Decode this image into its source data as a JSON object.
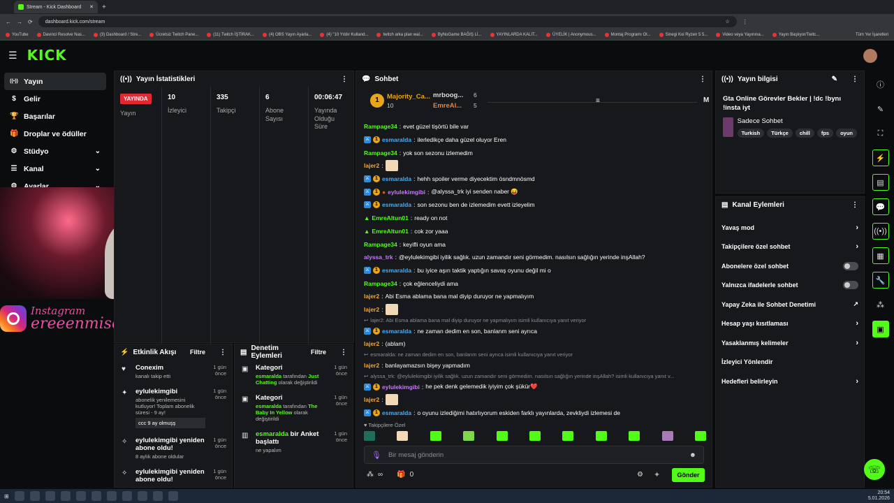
{
  "browser": {
    "tab_title": "Stream - Kick Dashboard",
    "url": "dashboard.kick.com/stream",
    "bookmarks": [
      "YouTube",
      "Davinci Resolve Nas...",
      "(3) Dashboard / Stre...",
      "Ücretsiz Twitch Pane...",
      "(11) Twitch İŞTİRAK...",
      "(4) OBS Yayın Ayarla...",
      "(4) \"10 Yıldır Kulland...",
      "twitch arka plan wal...",
      "ByNoGame BAĞIŞ Lİ...",
      "YAYINLARDA KALIT...",
      "ÜYELİK | Anonymous...",
      "Montaj Programı Ol...",
      "Sinegi Koi Ryzen 5 5...",
      "Video veya Yayınına...",
      "Yayın Başlıyor/Twitc..."
    ],
    "all_bookmarks": "Tüm Yer İşaretleri"
  },
  "app": {
    "logo": "KICK"
  },
  "sidebar": {
    "items": [
      {
        "label": "Yayın",
        "icon": "broadcast-icon",
        "active": true
      },
      {
        "label": "Gelir",
        "icon": "dollar-icon"
      },
      {
        "label": "Başarılar",
        "icon": "trophy-icon"
      },
      {
        "label": "Droplar ve ödüller",
        "icon": "gift-icon"
      },
      {
        "label": "Stüdyo",
        "icon": "gear-icon",
        "chevron": true
      },
      {
        "label": "Kanal",
        "icon": "list-icon",
        "chevron": true
      },
      {
        "label": "Ayarlar",
        "icon": "settings-icon",
        "chevron": true
      }
    ]
  },
  "overlay": {
    "instagram_label": "Instagram",
    "instagram_handle": "ereeenmise"
  },
  "stats": {
    "title": "Yayın İstatistikleri",
    "live_badge": "YAYINDA",
    "columns": [
      {
        "value": "",
        "label": "Yayın"
      },
      {
        "value": "10",
        "label": "İzleyici"
      },
      {
        "value": "335",
        "label": "Takipçi"
      },
      {
        "value": "6",
        "label": "Abone Sayısı"
      },
      {
        "value": "00:06:47",
        "label": "Yayında Olduğu Süre"
      }
    ]
  },
  "activity": {
    "title": "Etkinlik Akışı",
    "filter": "Filtre",
    "items": [
      {
        "who": "Conexim",
        "sub": "kanalı takip etti",
        "time": "1 gün önce",
        "icon": "heart-icon"
      },
      {
        "who": "eylulekimgibi",
        "sub": "abonelik yenilemesini kutluyor! Toplam abonelik süresi - 9 ay!",
        "extra": "ccc 9 ay olmuşş",
        "time": "1 gün önce",
        "icon": "star-icon"
      },
      {
        "who": "eylulekimgibi yeniden abone oldu!",
        "sub": "8 aylık abone oldular",
        "time": "1 gün önce",
        "icon": "sparkle-icon"
      },
      {
        "who": "eylulekimgibi yeniden abone oldu!",
        "sub": "",
        "time": "1 gün önce",
        "icon": "sparkle-icon"
      }
    ]
  },
  "audit": {
    "title": "Denetim Eylemleri",
    "filter": "Filtre",
    "items": [
      {
        "title": "Kategori",
        "who": "esmaralda",
        "mid": " tarafından ",
        "what": "Just Chatting",
        "end": " olarak değiştirildi",
        "time": "1 gün önce"
      },
      {
        "title": "Kategori",
        "who": "esmaralda",
        "mid": " tarafından ",
        "what": "The Baby In Yellow",
        "end": " olarak değiştirildi",
        "time": "1 gün önce"
      },
      {
        "title": " bir Anket başlattı",
        "who": "esmaralda",
        "mid": "",
        "what": "",
        "end": "ne yapalım",
        "time": "1 gün önce"
      }
    ]
  },
  "chat": {
    "title": "Sohbet",
    "pinned": [
      {
        "name": "Majority_Ca...",
        "count": "10"
      },
      {
        "name": "mrboog...",
        "count": "6"
      },
      {
        "name": "EmreAl...",
        "count": "5"
      }
    ],
    "pinned_extra": "M",
    "messages": [
      {
        "user": "Rampage34",
        "color": "#53fc18",
        "text": "evet güzel tişörtü bile var",
        "badges": 0
      },
      {
        "user": "esmaralda",
        "color": "#3fb0ff",
        "text": "ilerledikçe daha güzel oluyor Eren",
        "badges": 2
      },
      {
        "user": "Rampage34",
        "color": "#53fc18",
        "text": "yok son sezonu izlemedim",
        "badges": 0
      },
      {
        "user": "lajer2",
        "color": "#f0a63c",
        "text": "[emote]",
        "badges": 0
      },
      {
        "user": "esmaralda",
        "color": "#3fb0ff",
        "text": "hehh spoiler verme diyecektim ösndmnösmd",
        "badges": 2
      },
      {
        "user": "eylulekimgibi",
        "color": "#c87aff",
        "text": "@alyssa_trk iyi senden naber 😝",
        "badges": 3
      },
      {
        "user": "esmaralda",
        "color": "#3fb0ff",
        "text": "son sezonu ben de izlemedim evett izleyelim",
        "badges": 2
      },
      {
        "user": "EmreAltun01",
        "color": "#53fc18",
        "text": "ready on not",
        "badges": 1
      },
      {
        "user": "EmreAltun01",
        "color": "#53fc18",
        "text": "cok zor yaaa",
        "badges": 1
      },
      {
        "user": "Rampage34",
        "color": "#53fc18",
        "text": "keyifli oyun ama",
        "badges": 0
      },
      {
        "user": "alyssa_trk",
        "color": "#c87aff",
        "text": "@eylulekimgibi iyilik sağlık. uzun zamandır seni görmedim. nasılsın sağlığın yerinde inşAllah?",
        "badges": 0
      },
      {
        "user": "esmaralda",
        "color": "#3fb0ff",
        "text": "bu iyice aşırı taktik yaptığın savaş oyunu değil mi o",
        "badges": 2
      },
      {
        "user": "Rampage34",
        "color": "#53fc18",
        "text": "çok eğlenceliydi ama",
        "badges": 0
      },
      {
        "user": "lajer2",
        "color": "#f0a63c",
        "text": "Abi Esma ablama bana mal diyip duruyor ne yapmalıyım",
        "badges": 0
      },
      {
        "user": "lajer2",
        "color": "#f0a63c",
        "text": "[emote]",
        "badges": 0
      }
    ],
    "reply1": "lajer2: Abi Esma ablama bana mal diyip duruyor ne yapmalıyım isimli kullanıcıya yanıt veriyor",
    "messages2": [
      {
        "user": "esmaralda",
        "color": "#3fb0ff",
        "text": "ne zaman dedim en son, banlanm seni ayrıca",
        "badges": 2
      },
      {
        "user": "lajer2",
        "color": "#f0a63c",
        "text": "(ablam)",
        "badges": 0
      }
    ],
    "reply2": "esmaralda: ne zaman dedim en son, banlanm seni ayrıca isimli kullanıcıya yanıt veriyor",
    "messages3": [
      {
        "user": "lajer2",
        "color": "#f0a63c",
        "text": "banlayamazsın bişey yapmadım",
        "badges": 0
      }
    ],
    "reply3": "alyssa_trk: @eylulekimgibi iyilik sağlık. uzun zamandır seni görmedim. nasılsın sağlığın yerinde inşAllah? isimli kullanıcıya yanıt v...",
    "messages4": [
      {
        "user": "eylulekimgibi",
        "color": "#c87aff",
        "text": "he pek denk gelemedik iyiyim çok şükür❤️",
        "badges": 2
      },
      {
        "user": "lajer2",
        "color": "#f0a63c",
        "text": "[emote]",
        "badges": 0
      },
      {
        "user": "esmaralda",
        "color": "#3fb0ff",
        "text": "o oyunu izlediğimi hatırlıyorum eskiden farklı yayınlarda, zevkliydi izlemesi de",
        "badges": 2
      }
    ],
    "follower_only": "Takipçilere Özel",
    "input_placeholder": "Bir mesaj gönderin",
    "points": "∞",
    "gift_count": "0",
    "send_label": "Gönder"
  },
  "stream_info": {
    "title": "Yayın bilgisi",
    "stream_title": "Gta Online Görevler Bekler | !dc !bynı !insta iyt",
    "category": "Sadece Sohbet",
    "tags": [
      "Turkish",
      "Türkçe",
      "chill",
      "fps",
      "oyun"
    ]
  },
  "channel_actions": {
    "title": "Kanal Eylemleri",
    "items": [
      {
        "label": "Yavaş mod",
        "type": "chevron"
      },
      {
        "label": "Takipçilere özel sohbet",
        "type": "chevron"
      },
      {
        "label": "Abonelere özel sohbet",
        "type": "toggle"
      },
      {
        "label": "Yalnızca ifadelerle sohbet",
        "type": "toggle"
      },
      {
        "label": "Yapay Zeka ile Sohbet Denetimi",
        "type": "external"
      },
      {
        "label": "Hesap yaşı kısıtlaması",
        "type": "chevron"
      },
      {
        "label": "Yasaklanmış kelimeler",
        "type": "chevron"
      },
      {
        "label": "İzleyici Yönlendir",
        "type": "none"
      },
      {
        "label": "Hedefleri belirleyin",
        "type": "chevron"
      }
    ]
  },
  "taskbar": {
    "time": "20:54",
    "date": "5.01.2026"
  },
  "colors": {
    "accent": "#53fc18",
    "live": "#e32733",
    "panel": "#17181b"
  }
}
